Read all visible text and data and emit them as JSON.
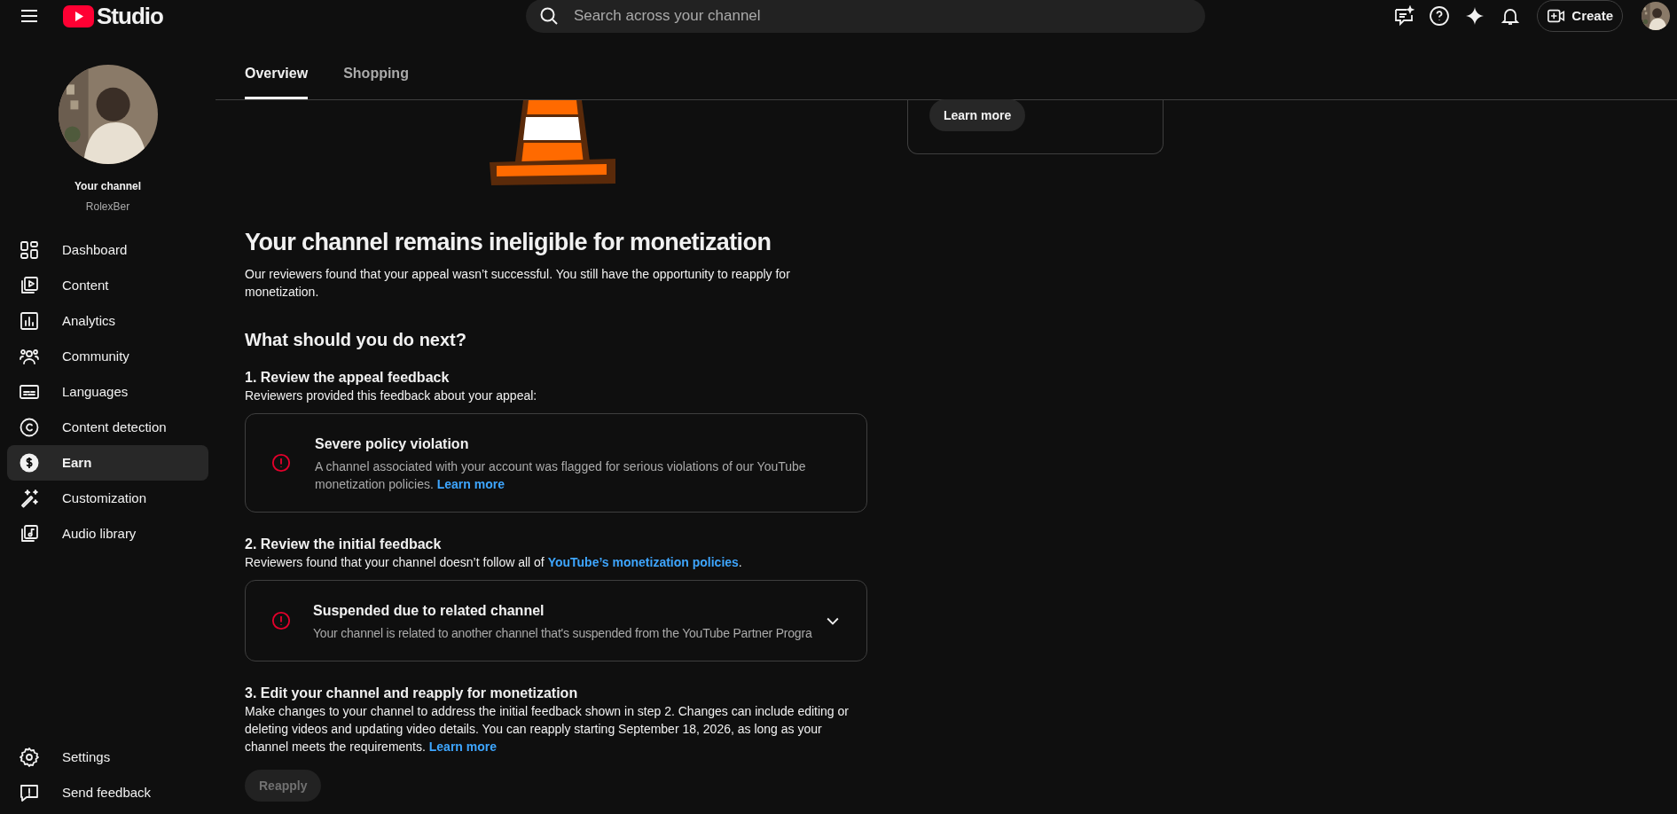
{
  "topbar": {
    "logo_text": "Studio",
    "search": {
      "placeholder": "Search across your channel"
    },
    "create_button": "Create"
  },
  "sidebar": {
    "channel_title": "Your channel",
    "channel_name": "RolexBer",
    "items": [
      {
        "label": "Dashboard",
        "kind": "dashboard",
        "selected": false
      },
      {
        "label": "Content",
        "kind": "content",
        "selected": false
      },
      {
        "label": "Analytics",
        "kind": "analytics",
        "selected": false
      },
      {
        "label": "Community",
        "kind": "community",
        "selected": false
      },
      {
        "label": "Languages",
        "kind": "languages",
        "selected": false
      },
      {
        "label": "Content detection",
        "kind": "copyright",
        "selected": false
      },
      {
        "label": "Earn",
        "kind": "earn",
        "selected": true
      },
      {
        "label": "Customization",
        "kind": "wand",
        "selected": false
      },
      {
        "label": "Audio library",
        "kind": "audio",
        "selected": false
      }
    ],
    "bottom_items": [
      {
        "label": "Settings",
        "kind": "settings"
      },
      {
        "label": "Send feedback",
        "kind": "feedback"
      }
    ]
  },
  "tabs": [
    {
      "label": "Overview",
      "selected": true
    },
    {
      "label": "Shopping",
      "selected": false
    }
  ],
  "side_card": {
    "button": "Learn more"
  },
  "main": {
    "title": "Your channel remains ineligible for monetization",
    "intro": "Our reviewers found that your appeal wasn’t successful. You still have the opportunity to reapply for monetization.",
    "subtitle": "What should you do next?",
    "steps": [
      {
        "heading": "1. Review the appeal feedback",
        "text": [
          {
            "text": "Reviewers provided this feedback about your appeal:"
          }
        ],
        "card": {
          "title": "Severe policy violation",
          "body": [
            {
              "text": "A channel associated with your account was flagged for serious violations of our YouTube monetization policies. "
            },
            {
              "link": "Learn more"
            }
          ]
        }
      },
      {
        "heading": "2. Review the initial feedback",
        "text": [
          {
            "text": "Reviewers found that your channel doesn’t follow all of "
          },
          {
            "link": "YouTube’s monetization policies"
          },
          {
            "text": "."
          }
        ],
        "card": {
          "title": "Suspended due to related channel",
          "body": [
            {
              "text": "Your channel is related to another channel that's suspended from the YouTube Partner Progra"
            }
          ],
          "expanded": false
        }
      },
      {
        "heading": "3. Edit your channel and reapply for monetization",
        "text": [
          {
            "text": "Make changes to your channel to address the initial feedback shown in step 2. Changes can include editing or deleting videos and updating video details. You can reapply starting September 18, 2026, as long as your channel meets the requirements. "
          },
          {
            "link": "Learn more"
          }
        ],
        "button": {
          "label": "Reapply",
          "disabled": true
        }
      }
    ]
  }
}
